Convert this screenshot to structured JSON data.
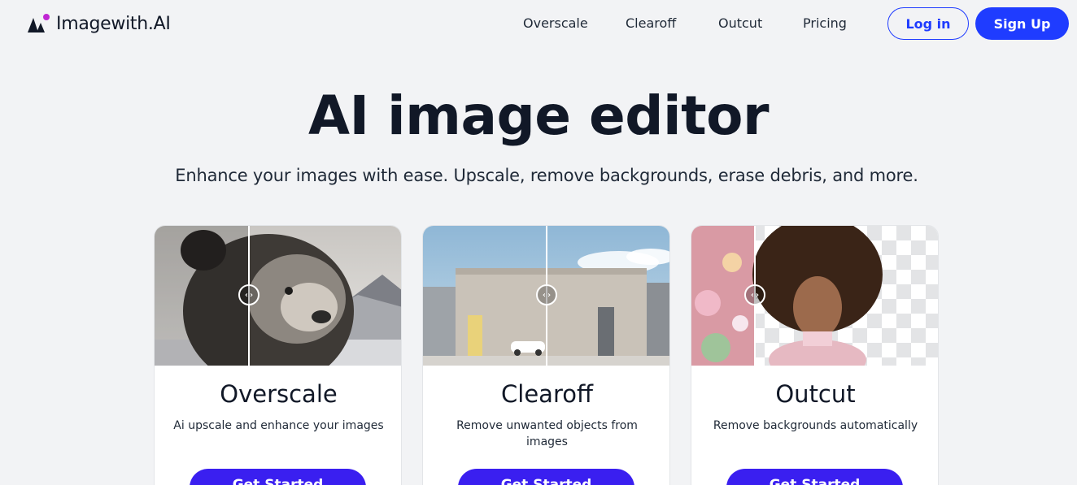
{
  "brand": {
    "name": "Imagewith.AI",
    "colors": {
      "primary": "#1f3cff",
      "cta": "#3a1ff0",
      "dot": "#c026d3"
    }
  },
  "nav": {
    "items": [
      {
        "label": "Overscale"
      },
      {
        "label": "Clearoff"
      },
      {
        "label": "Outcut"
      },
      {
        "label": "Pricing"
      }
    ],
    "login_label": "Log in",
    "signup_label": "Sign Up"
  },
  "hero": {
    "title": "AI image editor",
    "subtitle": "Enhance your images with ease. Upscale, remove backgrounds, erase debris, and more."
  },
  "cards": [
    {
      "title": "Overscale",
      "description": "Ai upscale and enhance your images",
      "button_label": "Get Started",
      "image": "snow-leopard-photo"
    },
    {
      "title": "Clearoff",
      "description": "Remove unwanted objects from images",
      "button_label": "Get Started",
      "image": "building-with-car-photo"
    },
    {
      "title": "Outcut",
      "description": "Remove backgrounds automatically",
      "button_label": "Get Started",
      "image": "portrait-curly-hair-photo"
    }
  ],
  "icons": {
    "compare_handle": "compare-arrows-icon"
  }
}
